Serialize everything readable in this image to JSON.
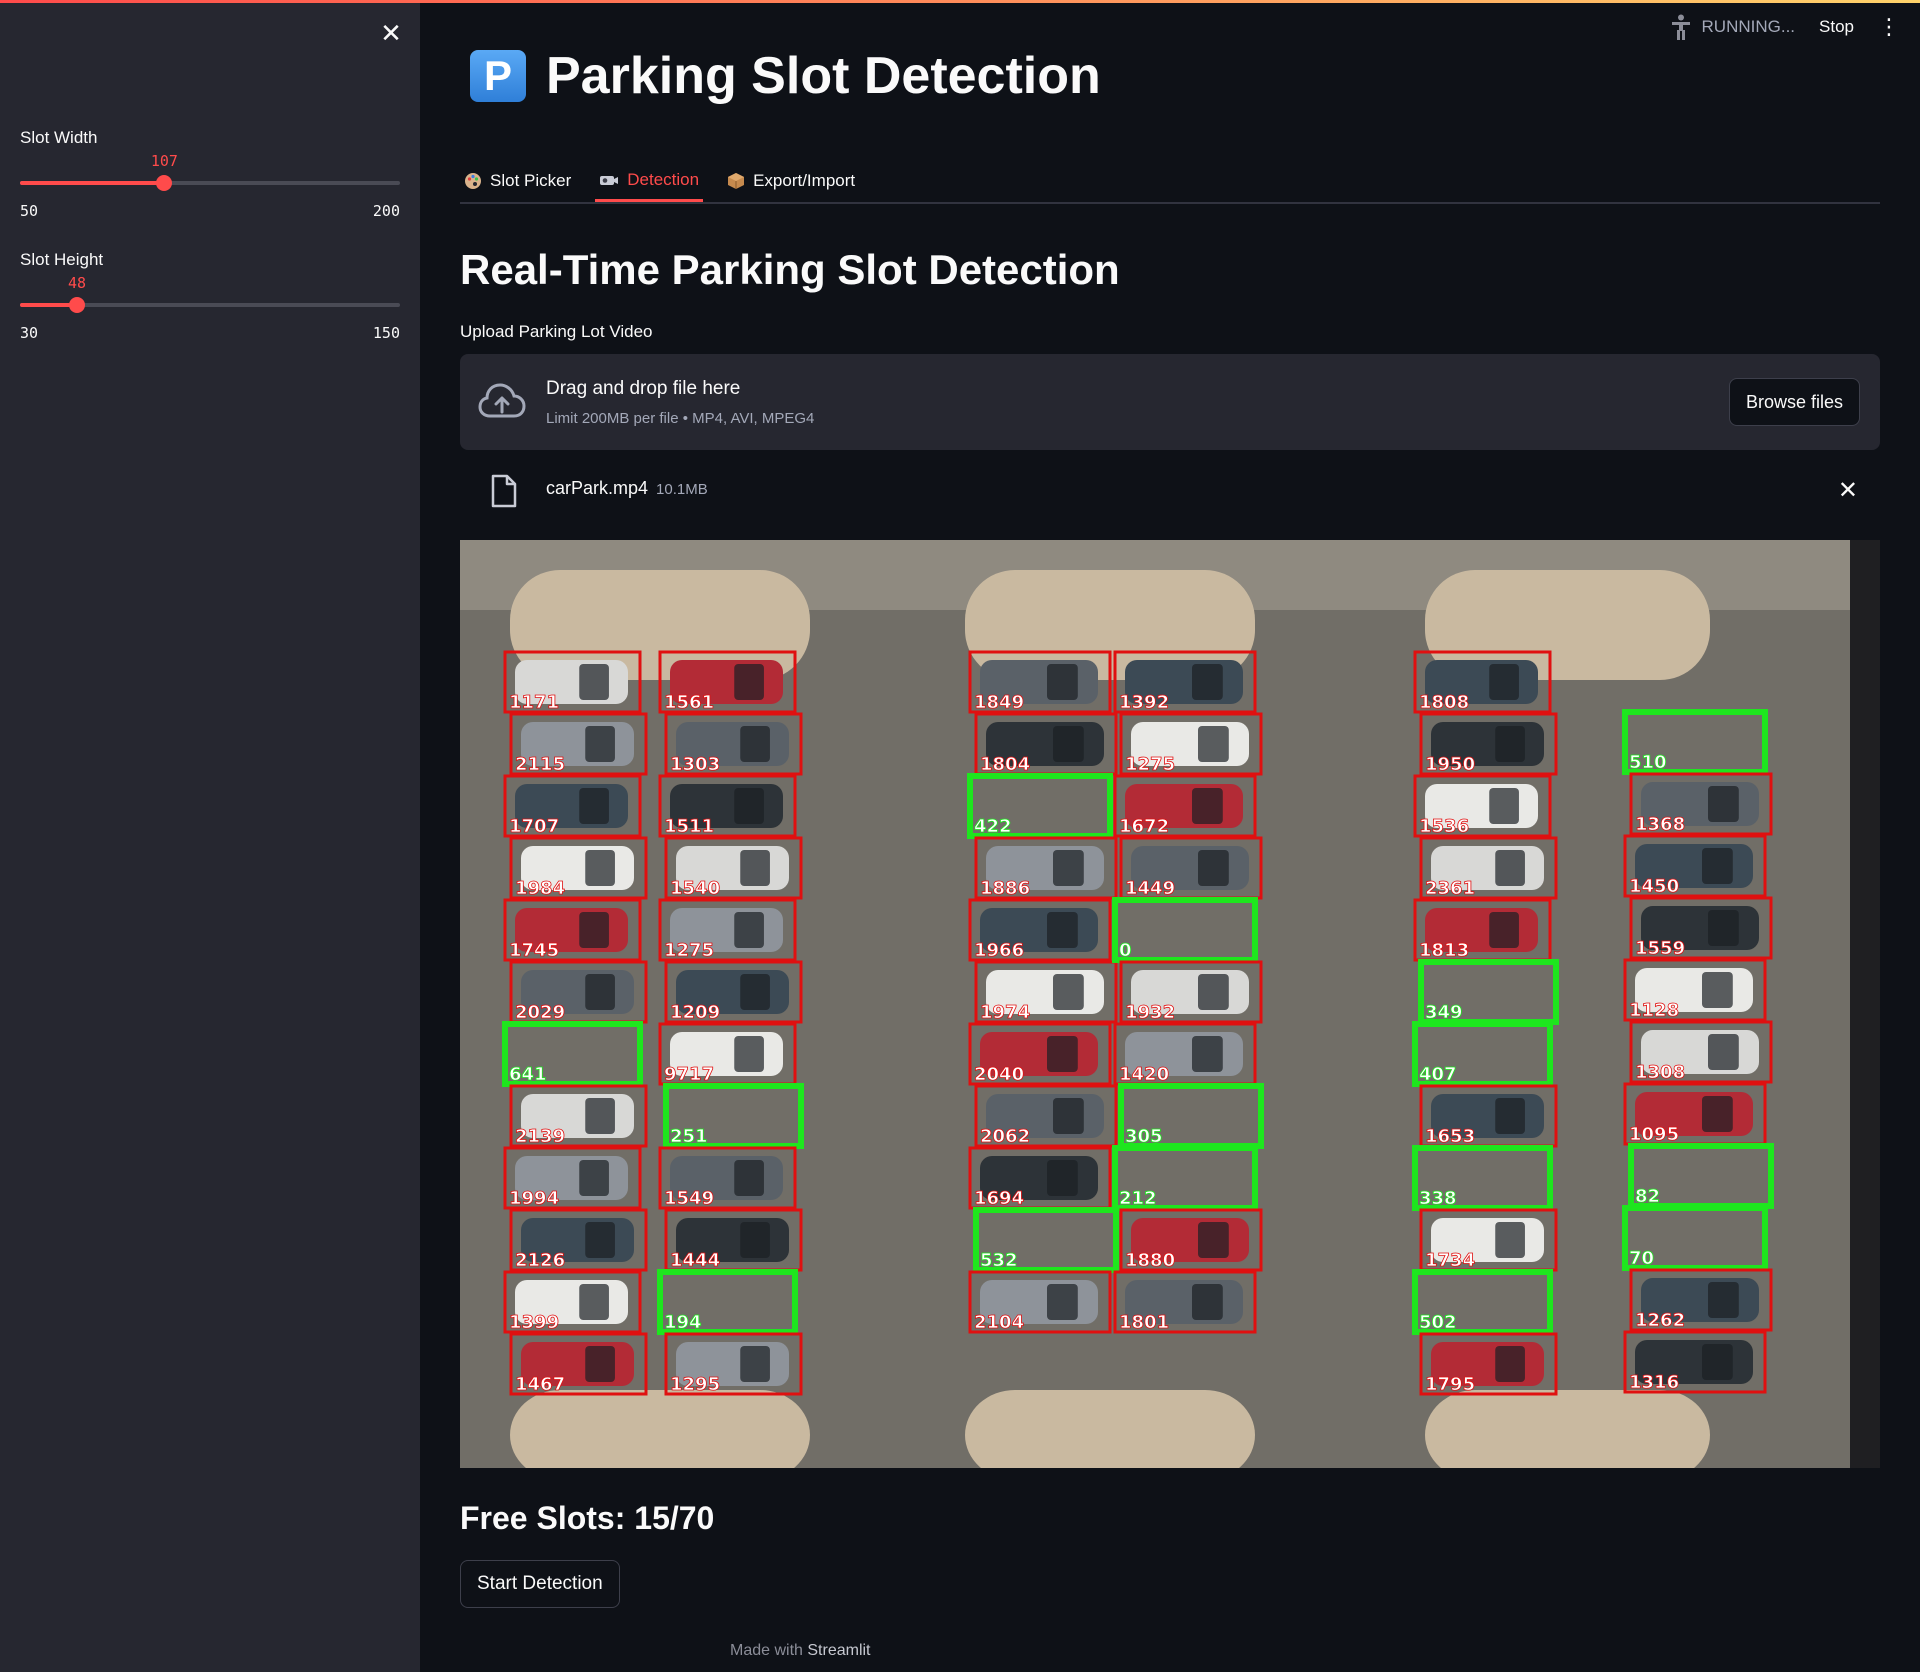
{
  "sidebar": {
    "close_icon": "close-icon",
    "sliders": [
      {
        "label": "Slot Width",
        "value": 107,
        "value_text": "107",
        "min": 50,
        "min_text": "50",
        "max": 200,
        "max_text": "200"
      },
      {
        "label": "Slot Height",
        "value": 48,
        "value_text": "48",
        "min": 30,
        "min_text": "30",
        "max": 150,
        "max_text": "150"
      }
    ]
  },
  "header": {
    "status": "RUNNING...",
    "stop_label": "Stop",
    "status_icon": "running-person-icon",
    "menu_icon": "kebab-menu-icon"
  },
  "main": {
    "title_icon": "P",
    "title": "Parking Slot Detection",
    "tabs": [
      {
        "label": "Slot Picker",
        "icon": "palette-icon",
        "active": false
      },
      {
        "label": "Detection",
        "icon": "camera-icon",
        "active": true
      },
      {
        "label": "Export/Import",
        "icon": "package-icon",
        "active": false
      }
    ],
    "subtitle": "Real-Time Parking Slot Detection",
    "upload": {
      "label": "Upload Parking Lot Video",
      "drag_text": "Drag and drop file here",
      "limit_text": "Limit 200MB per file • MP4, AVI, MPEG4",
      "browse_label": "Browse files",
      "icon": "cloud-upload-icon"
    },
    "file": {
      "name": "carPark.mp4",
      "size": "10.1MB",
      "icon": "file-icon",
      "remove_icon": "close-icon"
    },
    "video": {
      "slots": [
        {
          "n": "1171",
          "free": false
        },
        {
          "n": "1561",
          "free": false
        },
        {
          "n": "2115",
          "free": false
        },
        {
          "n": "1303",
          "free": false
        },
        {
          "n": "1707",
          "free": false
        },
        {
          "n": "1511",
          "free": false
        },
        {
          "n": "1984",
          "free": false
        },
        {
          "n": "1540",
          "free": false
        },
        {
          "n": "1745",
          "free": false
        },
        {
          "n": "1275",
          "free": false
        },
        {
          "n": "2029",
          "free": false
        },
        {
          "n": "1209",
          "free": false
        },
        {
          "n": "641",
          "free": true
        },
        {
          "n": "9717",
          "free": false
        },
        {
          "n": "2139",
          "free": false
        },
        {
          "n": "251",
          "free": true
        },
        {
          "n": "1994",
          "free": false
        },
        {
          "n": "1549",
          "free": false
        },
        {
          "n": "2126",
          "free": false
        },
        {
          "n": "1444",
          "free": false
        },
        {
          "n": "1399",
          "free": false
        },
        {
          "n": "194",
          "free": true
        },
        {
          "n": "1467",
          "free": false
        },
        {
          "n": "1295",
          "free": false
        },
        {
          "n": "1849",
          "free": false
        },
        {
          "n": "1392",
          "free": false
        },
        {
          "n": "1804",
          "free": false
        },
        {
          "n": "1275",
          "free": false
        },
        {
          "n": "422",
          "free": true
        },
        {
          "n": "1672",
          "free": false
        },
        {
          "n": "1886",
          "free": false
        },
        {
          "n": "1449",
          "free": false
        },
        {
          "n": "1966",
          "free": false
        },
        {
          "n": "0",
          "free": true
        },
        {
          "n": "1974",
          "free": false
        },
        {
          "n": "1932",
          "free": false
        },
        {
          "n": "2040",
          "free": false
        },
        {
          "n": "1420",
          "free": false
        },
        {
          "n": "2062",
          "free": false
        },
        {
          "n": "305",
          "free": true
        },
        {
          "n": "1694",
          "free": false
        },
        {
          "n": "212",
          "free": true
        },
        {
          "n": "532",
          "free": true
        },
        {
          "n": "1880",
          "free": false
        },
        {
          "n": "2104",
          "free": false
        },
        {
          "n": "1801",
          "free": false
        },
        {
          "n": "1808",
          "free": false
        },
        {
          "n": "1950",
          "free": false
        },
        {
          "n": "1536",
          "free": false
        },
        {
          "n": "2361",
          "free": false
        },
        {
          "n": "1813",
          "free": false
        },
        {
          "n": "349",
          "free": true
        },
        {
          "n": "407",
          "free": true
        },
        {
          "n": "1653",
          "free": false
        },
        {
          "n": "338",
          "free": true
        },
        {
          "n": "1734",
          "free": false
        },
        {
          "n": "502",
          "free": true
        },
        {
          "n": "1795",
          "free": false
        },
        {
          "n": "510",
          "free": true
        },
        {
          "n": "1368",
          "free": false
        },
        {
          "n": "1450",
          "free": false
        },
        {
          "n": "1559",
          "free": false
        },
        {
          "n": "1128",
          "free": false
        },
        {
          "n": "1308",
          "free": false
        },
        {
          "n": "1095",
          "free": false
        },
        {
          "n": "82",
          "free": true
        },
        {
          "n": "70",
          "free": true
        },
        {
          "n": "1262",
          "free": false
        },
        {
          "n": "1316",
          "free": false
        }
      ]
    },
    "free_slots_text": "Free Slots: 15/70",
    "start_label": "Start Detection"
  },
  "footer": {
    "prefix": "Made with",
    "brand": "Streamlit"
  },
  "colors": {
    "accent": "#ff4b4b",
    "occupied": "#e01010",
    "free": "#1ee61e",
    "background": "#0e1117",
    "sidebar": "#262730"
  }
}
